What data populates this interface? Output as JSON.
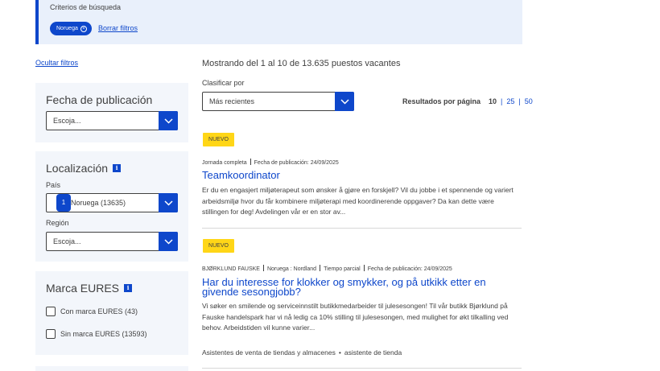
{
  "criteria": {
    "title": "Criterios de búsqueda",
    "chip_label": "Noruega",
    "chip_remove": "×",
    "clear_label": "Borrar filtros"
  },
  "hide_filters_label": "Ocultar filtros",
  "filters": {
    "publication_date": {
      "title": "Fecha de publicación",
      "select_value": "Escoja..."
    },
    "location": {
      "title": "Localización",
      "info_icon": "i",
      "country_label": "País",
      "country_value": "Noruega (13635)",
      "country_badge": "1",
      "region_label": "Región",
      "region_value": "Escoja..."
    },
    "eures_mark": {
      "title": "Marca EURES",
      "info_icon": "i",
      "options": [
        {
          "label": "Con marca EURES (43)",
          "checked": false
        },
        {
          "label": "Sin marca EURES (13593)",
          "checked": false
        }
      ]
    }
  },
  "results": {
    "summary": "Mostrando del 1 al 10 de 13.635 puestos vacantes",
    "sort_label": "Clasificar por",
    "sort_value": "Más recientes",
    "per_page_label": "Resultados por página",
    "per_page_options": [
      "10",
      "25",
      "50"
    ],
    "per_page_selected": "10"
  },
  "jobs": [
    {
      "badge": "NUEVO",
      "meta": [
        "Jornada completa",
        "Fecha de publicación: 24/09/2025"
      ],
      "title": "Teamkoordinator",
      "description": "Er du en engasjert miljøterapeut som ønsker å gjøre en forskjell? Vil du jobbe i et spennende og variert arbeidsmiljø hvor du får kombinere miljøterapi med koordinerende oppgaver? Da kan dette være stillingen for deg! Avdelingen vår er en stor av..."
    },
    {
      "badge": "NUEVO",
      "meta": [
        "BJØRKLUND FAUSKE",
        "Noruega : Nordland",
        "Tiempo parcial",
        "Fecha de publicación: 24/09/2025"
      ],
      "title": "Har du interesse for klokker og smykker, og på utkikk etter en givende sesongjobb?",
      "description": "Vi søker en smilende og serviceinnstilt butikkmedarbeider til julesesongen! Til vår butikk Bjørklund på Fauske handelspark har vi nå ledig ca 10% stilling til julesesongen, med mulighet for økt tilkalling ved behov. Arbeidstiden vil kunne varier...",
      "occupations": [
        "Asistentes de venta de tiendas y almacenes",
        "asistente de tienda"
      ]
    }
  ],
  "colors": {
    "primary": "#0e47cb",
    "badge_new": "#ffd617",
    "panel_bg": "#f3f6fb",
    "criteria_bg": "#e9f0fb"
  }
}
